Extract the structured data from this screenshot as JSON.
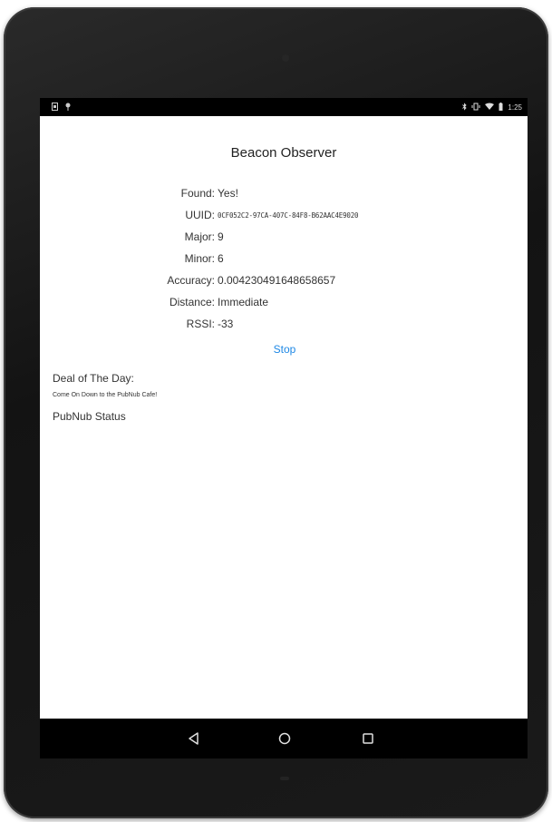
{
  "status_bar": {
    "time": "1:25",
    "left_icons": [
      "notification-icon",
      "location-pin-icon"
    ],
    "right_icons": [
      "bluetooth-icon",
      "vibrate-icon",
      "wifi-icon",
      "battery-icon"
    ]
  },
  "app": {
    "title": "Beacon Observer",
    "fields": [
      {
        "label": "Found:",
        "value": "Yes!"
      },
      {
        "label": "UUID:",
        "value": "0CF052C2-97CA-407C-84F8-B62AAC4E9020"
      },
      {
        "label": "Major:",
        "value": "9"
      },
      {
        "label": "Minor:",
        "value": "6"
      },
      {
        "label": "Accuracy:",
        "value": "0.004230491648658657"
      },
      {
        "label": "Distance:",
        "value": "Immediate"
      },
      {
        "label": "RSSI:",
        "value": "-33"
      }
    ],
    "stop_label": "Stop",
    "deal_label": "Deal of The Day:",
    "deal_text": "Come On Down to the PubNub Cafe!",
    "pubnub_status_label": "PubNub Status"
  },
  "nav_bar": {
    "buttons": [
      "back-icon",
      "home-icon",
      "recents-icon"
    ]
  },
  "colors": {
    "accent": "#1e88e5",
    "screen_bg": "#ffffff",
    "bars_bg": "#000000",
    "device_bezel": "#1a1a1a"
  }
}
